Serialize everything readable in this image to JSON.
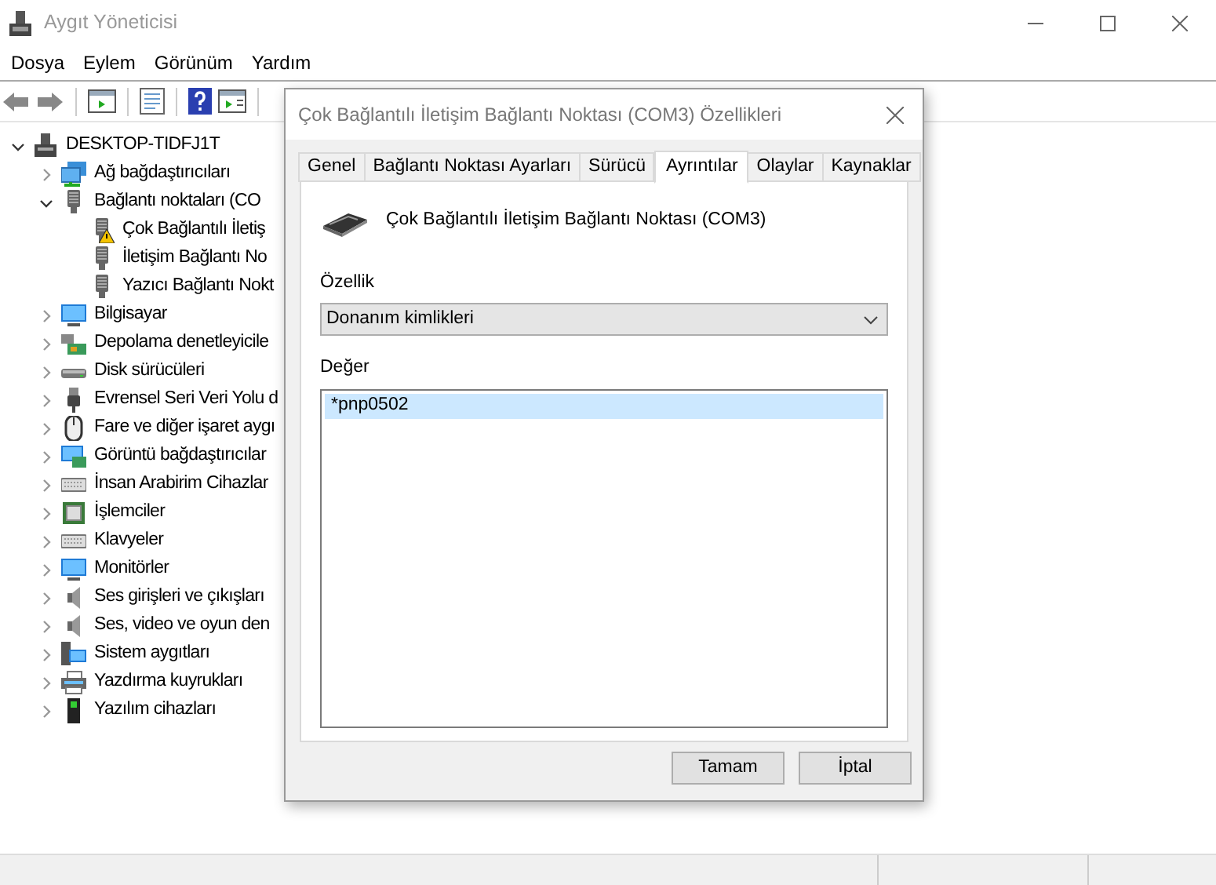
{
  "window": {
    "title": "Aygıt Yöneticisi"
  },
  "menu": [
    "Dosya",
    "Eylem",
    "Görünüm",
    "Yardım"
  ],
  "tree": {
    "label": "DESKTOP-TIDFJ1T",
    "kind": "computer",
    "expanded": true,
    "children": [
      {
        "label": "Ağ bağdaştırıcıları",
        "kind": "network",
        "expanded": false
      },
      {
        "label": "Bağlantı noktaları (CO",
        "kind": "port",
        "expanded": true,
        "children": [
          {
            "label": "Çok Bağlantılı İletiş",
            "kind": "port",
            "warning": true
          },
          {
            "label": "İletişim Bağlantı No",
            "kind": "port",
            "warning": false
          },
          {
            "label": "Yazıcı Bağlantı Nokt",
            "kind": "port",
            "warning": false
          }
        ]
      },
      {
        "label": "Bilgisayar",
        "kind": "monitor",
        "expanded": false
      },
      {
        "label": "Depolama denetleyicile",
        "kind": "storage",
        "expanded": false
      },
      {
        "label": "Disk sürücüleri",
        "kind": "disk",
        "expanded": false
      },
      {
        "label": "Evrensel Seri Veri Yolu d",
        "kind": "usb",
        "expanded": false
      },
      {
        "label": "Fare ve diğer işaret aygı",
        "kind": "mouse",
        "expanded": false
      },
      {
        "label": "Görüntü bağdaştırıcılar",
        "kind": "display",
        "expanded": false
      },
      {
        "label": "İnsan Arabirim Cihazlar",
        "kind": "keyboard",
        "expanded": false
      },
      {
        "label": "İşlemciler",
        "kind": "chip",
        "expanded": false
      },
      {
        "label": "Klavyeler",
        "kind": "keyboard",
        "expanded": false
      },
      {
        "label": "Monitörler",
        "kind": "monitor",
        "expanded": false
      },
      {
        "label": "Ses girişleri ve çıkışları",
        "kind": "speaker",
        "expanded": false
      },
      {
        "label": "Ses, video ve oyun den",
        "kind": "speaker",
        "expanded": false
      },
      {
        "label": "Sistem aygıtları",
        "kind": "system",
        "expanded": false
      },
      {
        "label": "Yazdırma kuyrukları",
        "kind": "printer",
        "expanded": false
      },
      {
        "label": "Yazılım cihazları",
        "kind": "software",
        "expanded": false
      }
    ]
  },
  "dialog": {
    "title": "Çok Bağlantılı İletişim Bağlantı Noktası (COM3) Özellikleri",
    "tabs": [
      {
        "label": "Genel",
        "selected": false
      },
      {
        "label": "Bağlantı Noktası Ayarları",
        "selected": false
      },
      {
        "label": "Sürücü",
        "selected": false
      },
      {
        "label": "Ayrıntılar",
        "selected": true
      },
      {
        "label": "Olaylar",
        "selected": false
      },
      {
        "label": "Kaynaklar",
        "selected": false
      }
    ],
    "device_name": "Çok Bağlantılı İletişim Bağlantı Noktası (COM3)",
    "property_label": "Özellik",
    "property_value": "Donanım kimlikleri",
    "value_label": "Değer",
    "values": [
      {
        "text": "*pnp0502",
        "selected": true
      }
    ],
    "buttons": [
      "Tamam",
      "İptal"
    ]
  }
}
